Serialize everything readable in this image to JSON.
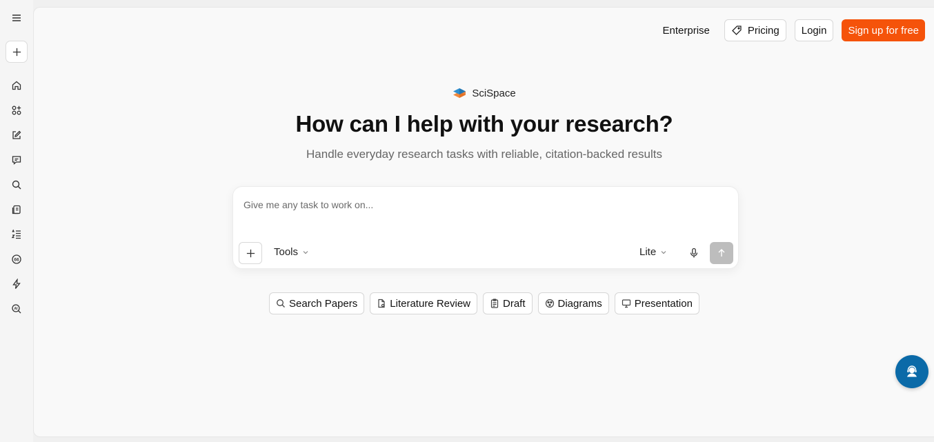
{
  "nav": {
    "enterprise": "Enterprise",
    "pricing": "Pricing",
    "login": "Login",
    "signup": "Sign up for free"
  },
  "brand": {
    "name": "SciSpace"
  },
  "hero": {
    "title": "How can I help with your research?",
    "subtitle": "Handle everyday research tasks with reliable, citation-backed results"
  },
  "prompt": {
    "placeholder": "Give me any task to work on...",
    "tools_label": "Tools",
    "model_label": "Lite"
  },
  "chips": [
    {
      "label": "Search Papers",
      "icon": "search-icon"
    },
    {
      "label": "Literature Review",
      "icon": "document-icon"
    },
    {
      "label": "Draft",
      "icon": "clipboard-icon"
    },
    {
      "label": "Diagrams",
      "icon": "diagram-icon"
    },
    {
      "label": "Presentation",
      "icon": "monitor-icon"
    }
  ],
  "sidebar": {
    "items": [
      {
        "icon": "home-icon"
      },
      {
        "icon": "apps-icon"
      },
      {
        "icon": "edit-icon"
      },
      {
        "icon": "chat-icon"
      },
      {
        "icon": "search-icon"
      },
      {
        "icon": "library-icon"
      },
      {
        "icon": "list-icon"
      },
      {
        "icon": "citation-icon"
      },
      {
        "icon": "lightning-icon"
      },
      {
        "icon": "ai-detector-icon"
      }
    ]
  },
  "colors": {
    "accent": "#f5530a",
    "fab": "#0b6aa8",
    "send_disabled": "#bdbdbd"
  }
}
